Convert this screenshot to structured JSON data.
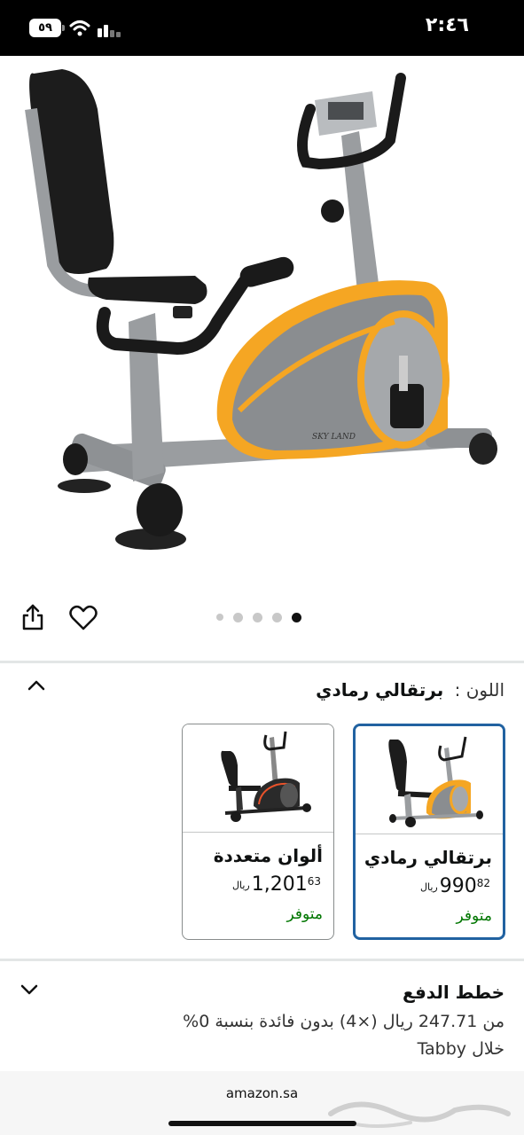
{
  "status_bar": {
    "time": "٢:٤٦",
    "battery": "٥٩"
  },
  "product": {
    "brand_logo_text": "SKY LAND",
    "image_count": 5,
    "active_image_index": 5
  },
  "color_selector": {
    "label": "اللون :",
    "selected_value": "برتقالي رمادي",
    "variants": [
      {
        "name": "برتقالي رمادي",
        "currency": "ريال",
        "price_whole": "990",
        "price_fraction": "82",
        "availability": "متوفر",
        "selected": true,
        "accent_color": "#f5a623"
      },
      {
        "name": "ألوان متعددة",
        "currency": "ريال",
        "price_whole": "1,201",
        "price_fraction": "63",
        "availability": "متوفر",
        "selected": false,
        "accent_color": "#e8522a"
      }
    ]
  },
  "payment_plans": {
    "title": "خطط الدفع",
    "line1": "من 247.71 ريال (×4) بدون فائدة بنسبة 0%",
    "line2": "خلال Tabby"
  },
  "browser": {
    "url": "amazon.sa",
    "watermark": "حراج"
  },
  "colors": {
    "selected_border": "#2162a1",
    "availability": "#007600",
    "bike_orange": "#f5a623",
    "bike_gray": "#8a8d90"
  },
  "icons": [
    "share-icon",
    "heart-icon",
    "chevron-up-icon",
    "chevron-down-icon",
    "wifi-icon",
    "signal-icon",
    "battery-icon"
  ]
}
